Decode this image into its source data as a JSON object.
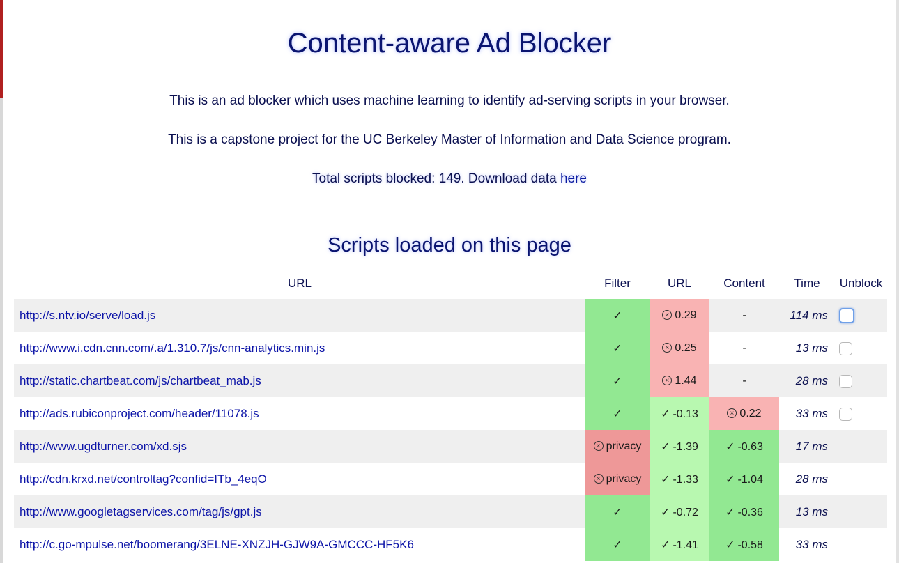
{
  "header": {
    "title": "Content-aware Ad Blocker",
    "description": "This is an ad blocker which uses machine learning to identify ad-serving scripts in your browser.",
    "capstone": "This is a capstone project for the UC Berkeley Master of Information and Data Science program.",
    "blocked_prefix": "Total scripts blocked: 149. Download data ",
    "download_link": "here"
  },
  "scripts_section": {
    "title": "Scripts loaded on this page",
    "columns": [
      "URL",
      "Filter",
      "URL",
      "Content",
      "Time",
      "Unblock"
    ],
    "rows": [
      {
        "url": "http://s.ntv.io/serve/load.js",
        "filter": "✓",
        "url_score": "0.29",
        "url_status": "bad",
        "content": "-",
        "content_status": "none",
        "time": "114 ms",
        "unblock": true,
        "focused": true
      },
      {
        "url": "http://www.i.cdn.cnn.com/.a/1.310.7/js/cnn-analytics.min.js",
        "filter": "✓",
        "url_score": "0.25",
        "url_status": "bad",
        "content": "-",
        "content_status": "none",
        "time": "13 ms",
        "unblock": true,
        "focused": false
      },
      {
        "url": "http://static.chartbeat.com/js/chartbeat_mab.js",
        "filter": "✓",
        "url_score": "1.44",
        "url_status": "bad",
        "content": "-",
        "content_status": "none",
        "time": "28 ms",
        "unblock": true,
        "focused": false
      },
      {
        "url": "http://ads.rubiconproject.com/header/11078.js",
        "filter": "✓",
        "url_score": "-0.13",
        "url_status": "ok",
        "content": "0.22",
        "content_status": "bad",
        "time": "33 ms",
        "unblock": true,
        "focused": false
      },
      {
        "url": "http://www.ugdturner.com/xd.sjs",
        "filter": "privacy",
        "filter_status": "bad",
        "url_score": "-1.39",
        "url_status": "ok",
        "content": "-0.63",
        "content_status": "ok",
        "time": "17 ms",
        "unblock": false,
        "focused": false
      },
      {
        "url": "http://cdn.krxd.net/controltag?confid=ITb_4eqO",
        "filter": "privacy",
        "filter_status": "bad",
        "url_score": "-1.33",
        "url_status": "ok",
        "content": "-1.04",
        "content_status": "ok",
        "time": "28 ms",
        "unblock": false,
        "focused": false
      },
      {
        "url": "http://www.googletagservices.com/tag/js/gpt.js",
        "filter": "✓",
        "url_score": "-0.72",
        "url_status": "ok",
        "content": "-0.36",
        "content_status": "ok",
        "time": "13 ms",
        "unblock": false,
        "focused": false
      },
      {
        "url": "http://c.go-mpulse.net/boomerang/3ELNE-XNZJH-GJW9A-GMCCC-HF5K6",
        "filter": "✓",
        "url_score": "-1.41",
        "url_status": "ok",
        "content": "-0.58",
        "content_status": "ok",
        "time": "33 ms",
        "unblock": false,
        "focused": false
      }
    ]
  },
  "colors": {
    "ok_dark": "#92e892",
    "ok_light": "#b8f8b0",
    "bad_dark": "#ee9898",
    "bad_light": "#f9b3b3",
    "link": "#0d15a8"
  },
  "icons": {
    "check": "check-icon",
    "blocked": "circled-x-icon"
  }
}
